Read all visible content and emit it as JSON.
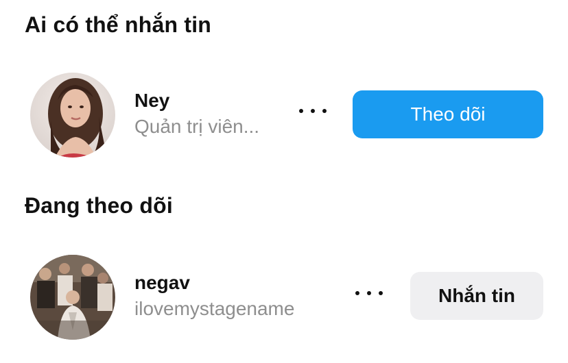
{
  "sections": [
    {
      "title": "Ai có thể nhắn tin",
      "user": {
        "name": "Ney",
        "subtitle": "Quản trị viên...",
        "action_label": "Theo dõi",
        "more_icon": "more-horizontal-icon"
      }
    },
    {
      "title": "Đang theo dõi",
      "user": {
        "name": "negav",
        "subtitle": "ilovemystagename",
        "action_label": "Nhắn tin",
        "more_icon": "more-horizontal-icon"
      }
    }
  ],
  "colors": {
    "follow_button": "#1a9bf0",
    "message_button": "#efeff1",
    "subtitle_text": "#8e8e8e"
  }
}
